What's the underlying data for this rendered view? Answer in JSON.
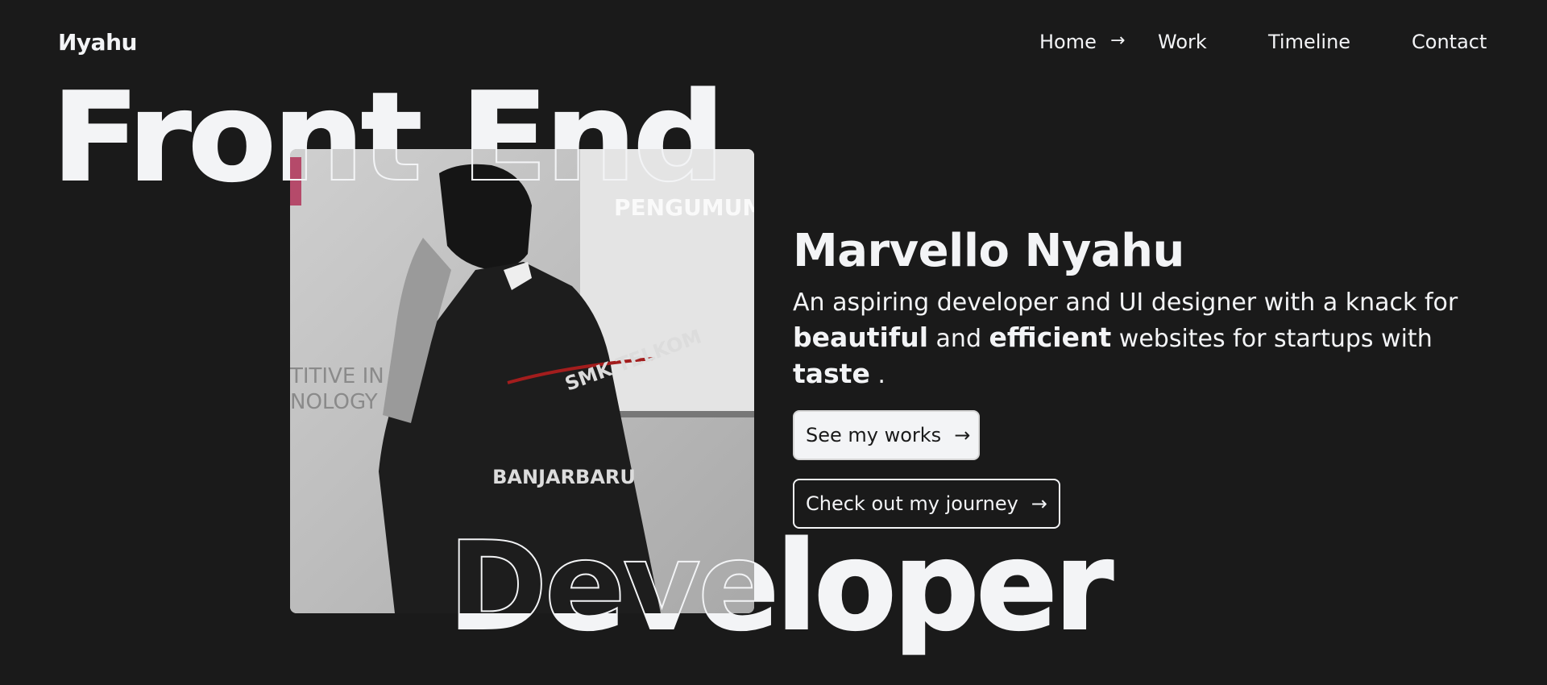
{
  "header": {
    "logo": "Иyahu",
    "nav": [
      {
        "label": "Home",
        "active": true,
        "indicator": "→"
      },
      {
        "label": "Work"
      },
      {
        "label": "Timeline"
      },
      {
        "label": "Contact"
      }
    ]
  },
  "hero": {
    "headline_top": "Front End",
    "headline_bottom": "Developer",
    "photo": {
      "description_texts": [
        "PENGUMUMA",
        "SMK TELKOM",
        "BANJARBARU",
        "TITIVE IN",
        "NOLOGY"
      ]
    },
    "name": "Marvello Nyahu",
    "desc": {
      "part1": "An aspiring developer and UI designer with a knack for ",
      "bold1": "beautiful",
      "part2": " and ",
      "bold2": "efficient",
      "part3": " websites for startups with ",
      "bold3": "taste",
      "part4": " ."
    },
    "buttons": {
      "works": {
        "label": "See my works",
        "icon": "→"
      },
      "journey": {
        "label": "Check out my journey",
        "icon": "→"
      }
    }
  },
  "colors": {
    "background": "#1a1a1a",
    "foreground": "#f3f4f6"
  }
}
